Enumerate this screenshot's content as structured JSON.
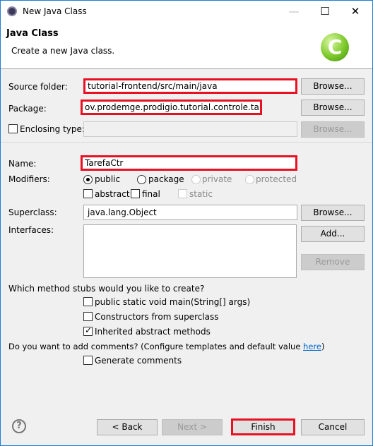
{
  "window": {
    "title": "New Java Class",
    "min_icon": "minimize-icon",
    "max_icon": "maximize-icon",
    "close_icon": "close-icon"
  },
  "header": {
    "title": "Java Class",
    "subtitle": "Create a new Java class.",
    "icon": "java-class-c-icon"
  },
  "form": {
    "source_folder": {
      "label": "Source folder:",
      "value": "tutorial-frontend/src/main/java",
      "browse": "Browse..."
    },
    "package": {
      "label": "Package:",
      "value": "ov.prodemge.prodigio.tutorial.controle.tarefa",
      "browse": "Browse..."
    },
    "enclosing": {
      "label": "Enclosing type:",
      "value": "",
      "checked": false,
      "browse": "Browse..."
    },
    "name": {
      "label": "Name:",
      "value": "TarefaCtr"
    },
    "modifiers": {
      "label": "Modifiers:",
      "public": "public",
      "package": "package",
      "private": "private",
      "protected": "protected",
      "selected": "public",
      "abstract": "abstract",
      "final": "final",
      "static": "static"
    },
    "superclass": {
      "label": "Superclass:",
      "value": "java.lang.Object",
      "browse": "Browse..."
    },
    "interfaces": {
      "label": "Interfaces:",
      "add": "Add...",
      "remove": "Remove"
    },
    "stubs": {
      "question": "Which method stubs would you like to create?",
      "main": "public static void main(String[] args)",
      "main_checked": false,
      "constructors": "Constructors from superclass",
      "constructors_checked": false,
      "inherited": "Inherited abstract methods",
      "inherited_checked": true
    },
    "comments": {
      "question": "Do you want to add comments? (Configure templates and default value ",
      "link": "here",
      "close": ")",
      "generate": "Generate comments",
      "generate_checked": false
    }
  },
  "footer": {
    "help": "?",
    "back": "< Back",
    "next": "Next >",
    "finish": "Finish",
    "cancel": "Cancel"
  },
  "colors": {
    "highlight": "#e81123",
    "accent": "#1c7ed6"
  }
}
